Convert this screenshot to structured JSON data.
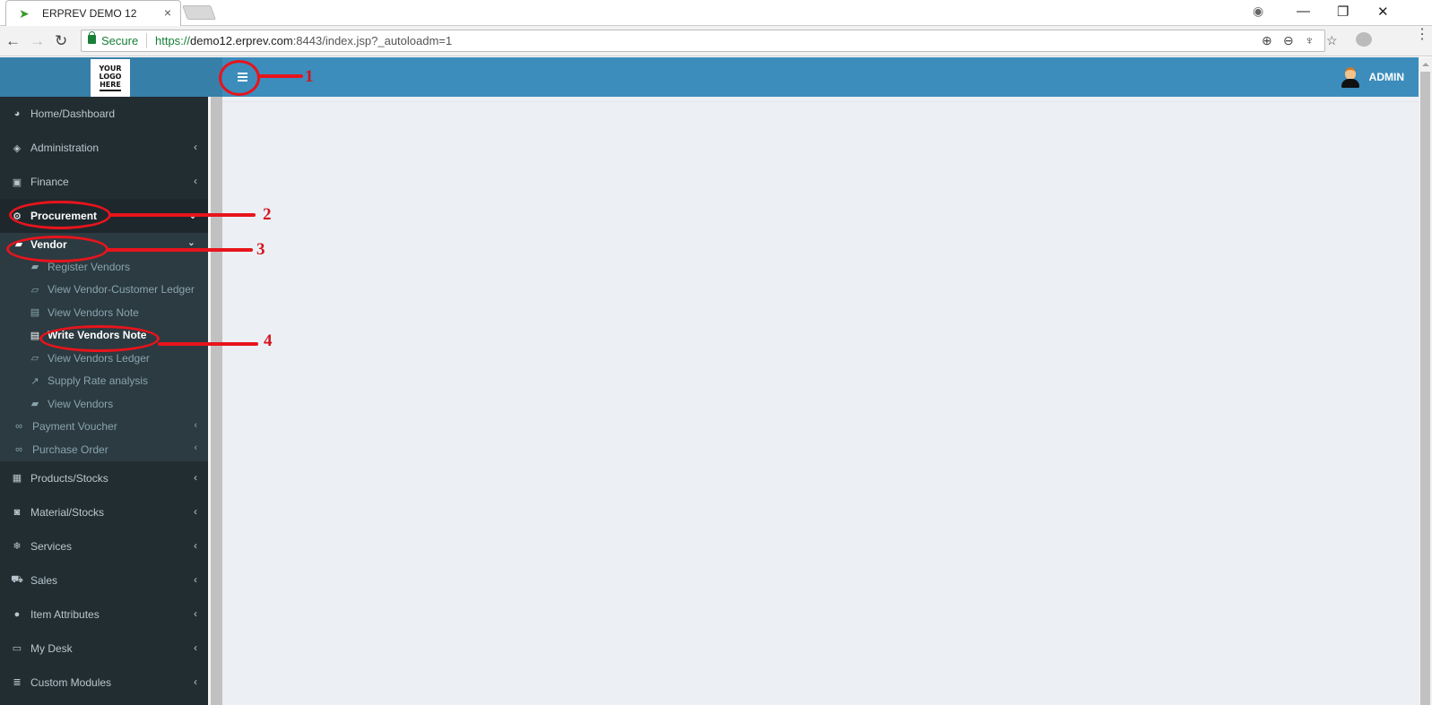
{
  "browser": {
    "tab_title": "ERPREV DEMO 12",
    "tab_close": "×",
    "security_label": "Secure",
    "url_scheme": "https://",
    "url_host": "demo12.erprev.com",
    "url_rest": ":8443/index.jsp?_autoloadm=1",
    "window_controls": {
      "minimize": "—",
      "restore": "❐",
      "close": "✕"
    },
    "nav": {
      "back": "←",
      "forward": "→",
      "reload": "↻"
    }
  },
  "app": {
    "logo_lines": [
      "YOUR",
      "LOGO",
      "HERE"
    ],
    "user_name": "ADMIN",
    "colors": {
      "header": "#3c8dbc",
      "logo_bg": "#367fa9",
      "sidebar": "#222d32",
      "annotation": "#e8141c"
    }
  },
  "sidebar": {
    "top_items": [
      {
        "label": "Home/Dashboard",
        "icon": "dashboard-icon",
        "glyph": "◕"
      },
      {
        "label": "Administration",
        "icon": "tag-icon",
        "glyph": "◈",
        "chevron": "‹"
      },
      {
        "label": "Finance",
        "icon": "money-icon",
        "glyph": "▣",
        "chevron": "‹"
      }
    ],
    "procurement": {
      "label": "Procurement",
      "icon": "cogs-icon",
      "glyph": "⚙",
      "chevron": "⌄"
    },
    "vendor": {
      "label": "Vendor",
      "icon": "bus-icon",
      "glyph": "▰",
      "chevron": "⌄"
    },
    "vendor_children": [
      {
        "label": "Register Vendors",
        "icon": "bus-icon",
        "glyph": "▰"
      },
      {
        "label": "View Vendor-Customer Ledger",
        "icon": "book-icon",
        "glyph": "▱"
      },
      {
        "label": "View Vendors Note",
        "icon": "file-text-icon",
        "glyph": "▤"
      },
      {
        "label": "Write Vendors Note",
        "icon": "file-edit-icon",
        "glyph": "▤"
      },
      {
        "label": "View Vendors Ledger",
        "icon": "book-icon",
        "glyph": "▱"
      },
      {
        "label": "Supply Rate analysis",
        "icon": "line-chart-icon",
        "glyph": "↗"
      },
      {
        "label": "View Vendors",
        "icon": "bus-icon",
        "glyph": "▰"
      }
    ],
    "procurement_others": [
      {
        "label": "Payment Voucher",
        "icon": "link-icon",
        "glyph": "∞",
        "chevron": "‹"
      },
      {
        "label": "Purchase Order",
        "icon": "link-icon",
        "glyph": "∞",
        "chevron": "‹"
      }
    ],
    "bottom_items": [
      {
        "label": "Products/Stocks",
        "icon": "building-icon",
        "glyph": "▦",
        "chevron": "‹"
      },
      {
        "label": "Material/Stocks",
        "icon": "bucket-icon",
        "glyph": "◙",
        "chevron": "‹"
      },
      {
        "label": "Services",
        "icon": "snowflake-icon",
        "glyph": "❄",
        "chevron": "‹"
      },
      {
        "label": "Sales",
        "icon": "cart-icon",
        "glyph": "⛟",
        "chevron": "‹"
      },
      {
        "label": "Item Attributes",
        "icon": "list-circle-icon",
        "glyph": "●",
        "chevron": "‹"
      },
      {
        "label": "My Desk",
        "icon": "desktop-icon",
        "glyph": "▭",
        "chevron": "‹"
      },
      {
        "label": "Custom Modules",
        "icon": "database-icon",
        "glyph": "≣",
        "chevron": "‹"
      }
    ]
  },
  "annotations": [
    "1",
    "2",
    "3",
    "4"
  ]
}
